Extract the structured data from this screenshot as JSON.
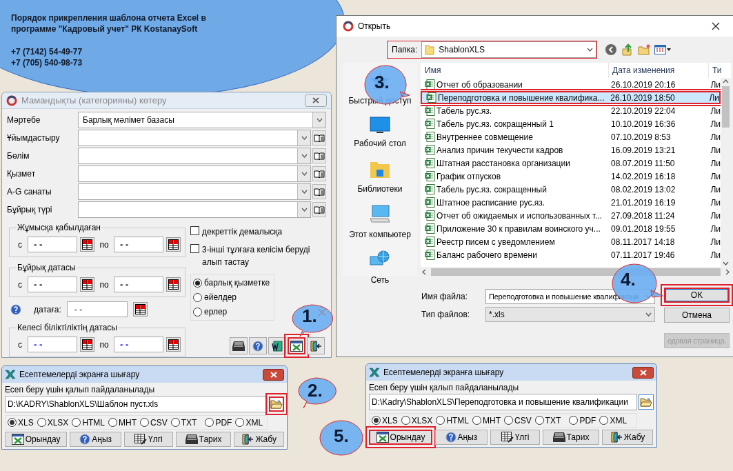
{
  "banner": {
    "title": "Порядок прикрепления шаблона отчета Excel в программе \"Кадровый учет\" РК KostanaySoft",
    "phones": [
      "+7 (7142) 54-49-77",
      "+7 (705) 540-98-73"
    ]
  },
  "category_dialog": {
    "title": "Мамандықты (категорияны) көтеру",
    "fields": [
      {
        "label": "Мәртебе",
        "value": "Барлық мәлімет базасы",
        "kind": "combo"
      },
      {
        "label": "Ұйымдастыру",
        "kind": "lookup"
      },
      {
        "label": "Бөлім",
        "kind": "lookup"
      },
      {
        "label": "Қызмет",
        "kind": "lookup"
      },
      {
        "label": "A-G санаты",
        "kind": "lookup"
      },
      {
        "label": "Бұйрық түрі",
        "kind": "lookup"
      }
    ],
    "date_groups": [
      {
        "title": "Жұмысқа қабылдаған",
        "from_label": "с",
        "from_value": "- -",
        "to_label": "по",
        "to_value": "- -",
        "color": "#000000"
      },
      {
        "title": "Бұйрық датасы",
        "from_label": "с",
        "from_value": "- -",
        "to_label": "по",
        "to_value": "- -",
        "color": "#000000"
      },
      {
        "title": "Келесі біліктіліктің датасы",
        "from_label": "с",
        "from_value": "- -",
        "to_label": "по",
        "to_value": "- -",
        "color": "#0000ff"
      }
    ],
    "as_of": {
      "label": "датаға:",
      "value": "- -"
    },
    "checkboxes": [
      {
        "label": "декреттік демалысқа",
        "checked": false
      },
      {
        "label": "3-інші тұлғаға келісім беруді алып тастау",
        "checked": false
      }
    ],
    "radios": [
      {
        "label": "барлық қызметке",
        "selected": true
      },
      {
        "label": "әйелдер",
        "selected": false
      },
      {
        "label": "ерлер",
        "selected": false
      }
    ],
    "toolbar": [
      {
        "kind": "history",
        "highlighted": false
      },
      {
        "kind": "help",
        "highlighted": false
      },
      {
        "kind": "word",
        "highlighted": false
      },
      {
        "kind": "report",
        "highlighted": true
      },
      {
        "kind": "exit",
        "highlighted": false
      }
    ]
  },
  "open_dialog": {
    "title": "Открыть",
    "folder_label": "Папка:",
    "folder": "ShablonXLS",
    "folder_highlighted": true,
    "places": [
      {
        "label": "Быстрый доступ",
        "kind": "quick"
      },
      {
        "label": "Рабочий стол",
        "kind": "desktop"
      },
      {
        "label": "Библиотеки",
        "kind": "libraries"
      },
      {
        "label": "Этот компьютер",
        "kind": "computer"
      },
      {
        "label": "Сеть",
        "kind": "network"
      }
    ],
    "columns": [
      "Имя",
      "Дата изменения",
      "Ти"
    ],
    "files": [
      {
        "name": "Отчет об образовании",
        "date": "26.10.2019 20:16",
        "column_3": "Ли",
        "selected": false
      },
      {
        "name": "Переподготовка и повышение квалифика...",
        "date": "26.10.2019 18:50",
        "column_3": "Ли",
        "selected": true
      },
      {
        "name": "Табель рус.яз.",
        "date": "22.10.2019 22:04",
        "column_3": "Ли",
        "selected": false
      },
      {
        "name": "Табель рус.яз. сокращенный 1",
        "date": "10.10.2019 16:36",
        "column_3": "Ли",
        "selected": false
      },
      {
        "name": "Внутреннее совмещение",
        "date": "07.10.2019 8:53",
        "column_3": "Ли",
        "selected": false
      },
      {
        "name": "Анализ причин текучести кадров",
        "date": "16.09.2019 13:21",
        "column_3": "Ли",
        "selected": false
      },
      {
        "name": "Штатная расстановка организации",
        "date": "08.07.2019 11:50",
        "column_3": "Ли",
        "selected": false
      },
      {
        "name": "График отпусков",
        "date": "14.02.2019 16:18",
        "column_3": "Ли",
        "selected": false
      },
      {
        "name": "Табель рус.яз. сокращенный",
        "date": "08.02.2019 13:02",
        "column_3": "Ли",
        "selected": false
      },
      {
        "name": "Штатное расписание рус.яз.",
        "date": "21.01.2019 16:19",
        "column_3": "Ли",
        "selected": false
      },
      {
        "name": "Отчет об ожидаемых и использованных т...",
        "date": "27.09.2018 11:24",
        "column_3": "Ли",
        "selected": false
      },
      {
        "name": "Приложение 30 к правилам воинского уч...",
        "date": "09.01.2018 19:55",
        "column_3": "Ли",
        "selected": false
      },
      {
        "name": "Реестр писем с уведомлением",
        "date": "08.11.2017 14:18",
        "column_3": "Ли",
        "selected": false
      },
      {
        "name": "Баланс рабочего времени",
        "date": "07.11.2017 19:46",
        "column_3": "Ли",
        "selected": false
      }
    ],
    "file_name_label": "Имя файла:",
    "file_name": "Переподготовка и повышение квалификаци",
    "file_type_label": "Тип файлов:",
    "file_type": "*.xls",
    "buttons": [
      {
        "label": "OK",
        "disabled": false,
        "highlighted": true
      },
      {
        "label": "Отмена",
        "disabled": false,
        "highlighted": false
      },
      {
        "label": "одовая страница.",
        "disabled": true,
        "highlighted": false
      }
    ]
  },
  "report_dialogs": [
    {
      "title": "Есептемелерді экранға шығару",
      "template_label": "Есеп беру үшін қалып пайдаланылады",
      "path": "D:\\KADRY\\ShablonXLS\\Шаблон пуст.xls",
      "browse_highlighted": true,
      "formats": [
        {
          "label": "XLS",
          "selected": true
        },
        {
          "label": "XLSX",
          "selected": false
        },
        {
          "label": "HTML",
          "selected": false
        },
        {
          "label": "MHT",
          "selected": false
        },
        {
          "label": "CSV",
          "selected": false
        },
        {
          "label": "TXT",
          "selected": false
        },
        {
          "label": "PDF",
          "selected": false
        },
        {
          "label": "XML",
          "selected": false
        }
      ],
      "buttons": [
        {
          "label": "Орындау",
          "kind": "run",
          "highlighted": false
        },
        {
          "label": "Аңыз",
          "kind": "help",
          "highlighted": false
        },
        {
          "label": "Үлгі",
          "kind": "template",
          "highlighted": false
        },
        {
          "label": "Тарих",
          "kind": "history",
          "highlighted": false
        },
        {
          "label": "Жабу",
          "kind": "exit",
          "highlighted": false
        }
      ]
    },
    {
      "title": "Есептемелерді экранға шығару",
      "template_label": "Есеп беру үшін қалып пайдаланылады",
      "path": "D:\\Kadry\\ShablonXLS\\Переподготовка и повышение квалификации",
      "browse_highlighted": false,
      "formats": [
        {
          "label": "XLS",
          "selected": true
        },
        {
          "label": "XLSX",
          "selected": false
        },
        {
          "label": "HTML",
          "selected": false
        },
        {
          "label": "MHT",
          "selected": false
        },
        {
          "label": "CSV",
          "selected": false
        },
        {
          "label": "TXT",
          "selected": false
        },
        {
          "label": "PDF",
          "selected": false
        },
        {
          "label": "XML",
          "selected": false
        }
      ],
      "buttons": [
        {
          "label": "Орындау",
          "kind": "run",
          "highlighted": true
        },
        {
          "label": "Аңыз",
          "kind": "help",
          "highlighted": false
        },
        {
          "label": "Үлгі",
          "kind": "template",
          "highlighted": false
        },
        {
          "label": "Тарих",
          "kind": "history",
          "highlighted": false
        },
        {
          "label": "Жабу",
          "kind": "exit",
          "highlighted": false
        }
      ]
    }
  ],
  "callouts": [
    {
      "label": "1."
    },
    {
      "label": "2."
    },
    {
      "label": "3."
    },
    {
      "label": "4."
    },
    {
      "label": "5."
    }
  ]
}
